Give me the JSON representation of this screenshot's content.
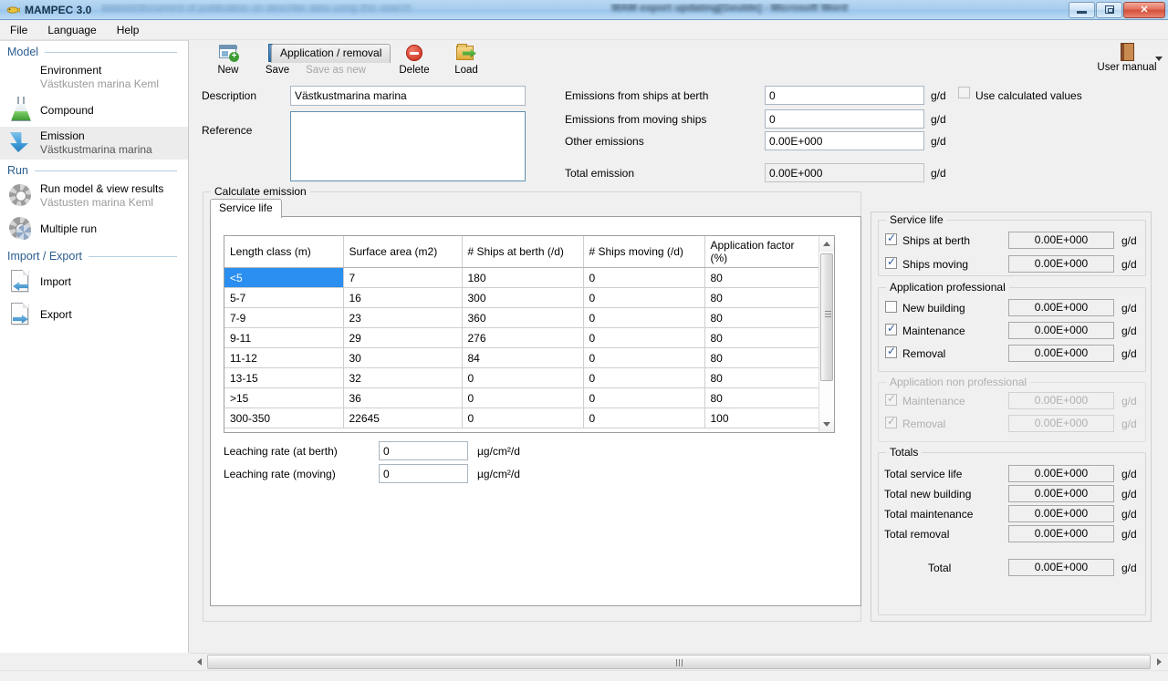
{
  "window": {
    "app_title": "MAMPEC 3.0",
    "blurred_title_1": "dataset/document of publication on describe data using this search",
    "blurred_title_2": "MAM export updating[Geulde] - Microsoft Word",
    "controls": {
      "minimize": "Minimize",
      "restore": "Restore",
      "close": "Close"
    }
  },
  "menu": {
    "items": [
      "File",
      "Language",
      "Help"
    ]
  },
  "sidebar": {
    "groups": [
      {
        "label": "Model",
        "items": [
          {
            "icon": "leaf-icon",
            "title": "Environment",
            "subtitle": "Västkusten marina Keml",
            "selected": false
          },
          {
            "icon": "flask-icon",
            "title": "Compound",
            "subtitle": "",
            "selected": false
          },
          {
            "icon": "emission-icon",
            "title": "Emission",
            "subtitle": "Västkustmarina marina",
            "selected": true
          }
        ]
      },
      {
        "label": "Run",
        "items": [
          {
            "icon": "gear-icon",
            "title": "Run model & view results",
            "subtitle": "Västusten marina Keml",
            "selected": false
          },
          {
            "icon": "multi-gear-icon",
            "title": "Multiple run",
            "subtitle": "",
            "selected": false
          }
        ]
      },
      {
        "label": "Import / Export",
        "items": [
          {
            "icon": "import-doc-icon",
            "title": "Import",
            "subtitle": "",
            "selected": false
          },
          {
            "icon": "export-doc-icon",
            "title": "Export",
            "subtitle": "",
            "selected": false
          }
        ]
      }
    ]
  },
  "toolbar": {
    "buttons": [
      {
        "label": "New",
        "icon": "new-record-icon",
        "disabled": false
      },
      {
        "label": "Save",
        "icon": "floppy-disk-icon",
        "disabled": false
      },
      {
        "label": "Save as new",
        "icon": "copy-icon",
        "disabled": true
      },
      {
        "label": "Delete",
        "icon": "delete-circle-icon",
        "disabled": false
      },
      {
        "label": "Load",
        "icon": "folder-arrow-icon",
        "disabled": false
      }
    ],
    "user_manual": {
      "label": "User manual",
      "icon": "book-icon"
    }
  },
  "header_form": {
    "description_label": "Description",
    "description_value": "Västkustmarina marina",
    "reference_label": "Reference",
    "reference_value": "",
    "emissions": [
      {
        "label": "Emissions from ships at berth",
        "value": "0",
        "unit": "g/d",
        "readonly": false
      },
      {
        "label": "Emissions from moving ships",
        "value": "0",
        "unit": "g/d",
        "readonly": false
      },
      {
        "label": "Other emissions",
        "value": "0.00E+000",
        "unit": "g/d",
        "readonly": false
      },
      {
        "label": "Total emission",
        "value": "0.00E+000",
        "unit": "g/d",
        "readonly": true
      }
    ],
    "use_calculated_values": {
      "label": "Use calculated values",
      "checked": false
    }
  },
  "calculate_emission": {
    "group_title": "Calculate emission",
    "tabs": [
      {
        "label": "Service life",
        "active": true
      },
      {
        "label": "Application / removal",
        "active": false
      }
    ]
  },
  "grid": {
    "columns": [
      "Length class (m)",
      "Surface area (m2)",
      "# Ships at berth (/d)",
      "# Ships moving (/d)",
      "Application factor (%)"
    ],
    "rows": [
      {
        "cells": [
          "<5",
          "7",
          "180",
          "0",
          "80"
        ],
        "selected": true
      },
      {
        "cells": [
          "5-7",
          "16",
          "300",
          "0",
          "80"
        ],
        "selected": false
      },
      {
        "cells": [
          "7-9",
          "23",
          "360",
          "0",
          "80"
        ],
        "selected": false
      },
      {
        "cells": [
          "9-11",
          "29",
          "276",
          "0",
          "80"
        ],
        "selected": false
      },
      {
        "cells": [
          "11-12",
          "30",
          "84",
          "0",
          "80"
        ],
        "selected": false
      },
      {
        "cells": [
          "13-15",
          "32",
          "0",
          "0",
          "80"
        ],
        "selected": false
      },
      {
        "cells": [
          ">15",
          "36",
          "0",
          "0",
          "80"
        ],
        "selected": false
      },
      {
        "cells": [
          "300-350",
          "22645",
          "0",
          "0",
          "100"
        ],
        "selected": false
      }
    ]
  },
  "leaching": [
    {
      "label": "Leaching rate (at berth)",
      "value": "0",
      "unit": "µg/cm²/d"
    },
    {
      "label": "Leaching rate (moving)",
      "value": "0",
      "unit": "µg/cm²/d"
    }
  ],
  "results": {
    "service_life": {
      "title": "Service life",
      "rows": [
        {
          "label": "Ships at berth",
          "checked": true,
          "value": "0.00E+000",
          "unit": "g/d",
          "disabled": false
        },
        {
          "label": "Ships moving",
          "checked": true,
          "value": "0.00E+000",
          "unit": "g/d",
          "disabled": false
        }
      ]
    },
    "application_professional": {
      "title": "Application professional",
      "rows": [
        {
          "label": "New building",
          "checked": false,
          "value": "0.00E+000",
          "unit": "g/d",
          "disabled": false
        },
        {
          "label": "Maintenance",
          "checked": true,
          "value": "0.00E+000",
          "unit": "g/d",
          "disabled": false
        },
        {
          "label": "Removal",
          "checked": true,
          "value": "0.00E+000",
          "unit": "g/d",
          "disabled": false
        }
      ]
    },
    "application_non_professional": {
      "title": "Application non professional",
      "disabled": true,
      "rows": [
        {
          "label": "Maintenance",
          "checked": true,
          "value": "0.00E+000",
          "unit": "g/d",
          "disabled": true
        },
        {
          "label": "Removal",
          "checked": true,
          "value": "0.00E+000",
          "unit": "g/d",
          "disabled": true
        }
      ]
    },
    "totals": {
      "title": "Totals",
      "rows": [
        {
          "label": "Total service life",
          "value": "0.00E+000",
          "unit": "g/d"
        },
        {
          "label": "Total new building",
          "value": "0.00E+000",
          "unit": "g/d"
        },
        {
          "label": "Total maintenance",
          "value": "0.00E+000",
          "unit": "g/d"
        },
        {
          "label": "Total removal",
          "value": "0.00E+000",
          "unit": "g/d"
        },
        {
          "label": "Total",
          "value": "0.00E+000",
          "unit": "g/d"
        }
      ]
    }
  }
}
